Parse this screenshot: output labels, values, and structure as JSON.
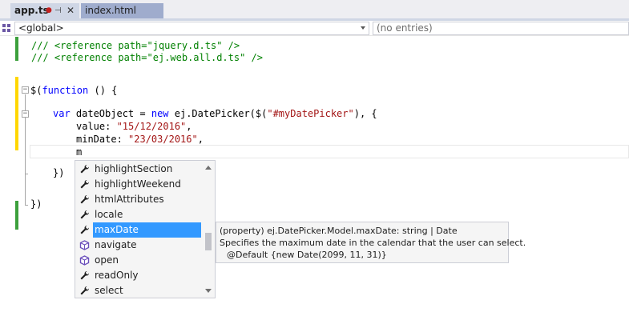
{
  "tabs": {
    "active": {
      "label": "app.ts",
      "dirty": "●",
      "pin": "⊣",
      "close": "✕"
    },
    "inactive": {
      "label": "index.html"
    }
  },
  "navbar": {
    "scope": "<global>",
    "members": "(no entries)"
  },
  "code": {
    "line1": "/// <reference path=\"jquery.d.ts\" />",
    "line2": "/// <reference path=\"ej.web.all.d.ts\" />",
    "line3_prefix": "$(",
    "line3_kw": "function",
    "line3_suffix": " () {",
    "line4_kw": "var",
    "line4_mid": " dateObject = ",
    "line4_kw2": "new",
    "line4_rest": " ej.DatePicker($(",
    "line4_str": "\"#myDatePicker\"",
    "line4_end": "), {",
    "line5_key": "value: ",
    "line5_str": "\"15/12/2016\"",
    "line5_end": ",",
    "line6_key": "minDate: ",
    "line6_str": "\"23/03/2016\"",
    "line6_end": ",",
    "line7": "m",
    "line8": "})",
    "line9": "})"
  },
  "completion": {
    "items": [
      {
        "label": "highlightSection",
        "icon": "wrench-icon"
      },
      {
        "label": "highlightWeekend",
        "icon": "wrench-icon"
      },
      {
        "label": "htmlAttributes",
        "icon": "wrench-icon"
      },
      {
        "label": "locale",
        "icon": "wrench-icon"
      },
      {
        "label": "maxDate",
        "icon": "wrench-icon",
        "selected": true
      },
      {
        "label": "navigate",
        "icon": "method-cube-icon"
      },
      {
        "label": "open",
        "icon": "method-cube-icon"
      },
      {
        "label": "readOnly",
        "icon": "wrench-icon"
      },
      {
        "label": "select",
        "icon": "wrench-icon"
      }
    ]
  },
  "tooltip": {
    "signature": "(property) ej.DatePicker.Model.maxDate: string | Date",
    "description": "Specifies the maximum date in the calendar that the user can select.",
    "default": "@Default {new Date(2099, 11, 31)}"
  },
  "colors": {
    "comment": "#008000",
    "keyword": "#0000ff",
    "string": "#a31515",
    "selection": "#3399ff",
    "saved_margin": "#3ca03c",
    "unsaved_margin": "#ffd700"
  }
}
